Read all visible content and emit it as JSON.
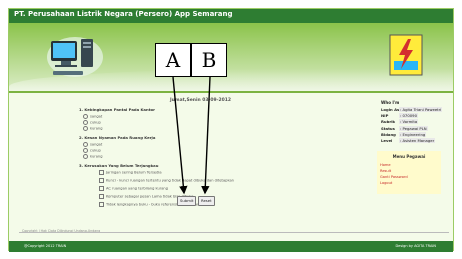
{
  "header": {
    "title": "PT. Perusahaan Listrik Negara (Persero) App Semarang"
  },
  "icons": {
    "computer": "desktop-computer-icon",
    "logo": "pln-lightning-logo"
  },
  "colors": {
    "brand": "#2e7d32",
    "accent": "#8bc34a",
    "menu_bg": "#fffbcc"
  },
  "survey": {
    "date_line": "Jumat,Senin 03-09-2012",
    "q1": {
      "question": "1. Kebingkapan Pantai Pada Kantor",
      "options": [
        "sangat",
        "cukup",
        "kurang"
      ]
    },
    "q2": {
      "question": "2. Kesan Nyaman Pada Ruang Kerja",
      "options": [
        "sangat",
        "cukup",
        "kurang"
      ]
    },
    "q3": {
      "question": "3. Kerusakan Yang Belum Terjangkau",
      "options": [
        "Jaringan sering Belum Tersedia",
        "Kunci - kunci ruangan tertentu yang tidak dapat dibuka dan ditetapkan",
        "AC ruangan yang terbilang kurang",
        "Komputer sebagai pesan Lama tidak bisa dibuka",
        "Tidak lengkapnya buku - buku referensi perusahaan"
      ]
    },
    "submit_label": "Submit",
    "reset_label": "Reset"
  },
  "annotations": {
    "a": "A",
    "b": "B"
  },
  "profile": {
    "heading": "Who I'm",
    "rows": [
      {
        "label": "Login As",
        "value": ": Agita Triani Paweetri"
      },
      {
        "label": "NIP",
        "value": ": 070090"
      },
      {
        "label": "Rubrik",
        "value": ": Vormita"
      },
      {
        "label": "Status",
        "value": ": Pegawai PLN"
      },
      {
        "label": "Bidang",
        "value": ": Engineering"
      },
      {
        "label": "Level",
        "value": ": Asisten Manager"
      }
    ]
  },
  "menu": {
    "title": "Menu Pegawai",
    "items": [
      "Home",
      "Result",
      "Ganti Password",
      "Logout"
    ]
  },
  "footer": {
    "note": "Copyright | Hak Cipta Dilindungi Undang-Undang",
    "left": "@Copyright 2012 TRAIN",
    "right": "Design by AGITA TRAIN"
  }
}
